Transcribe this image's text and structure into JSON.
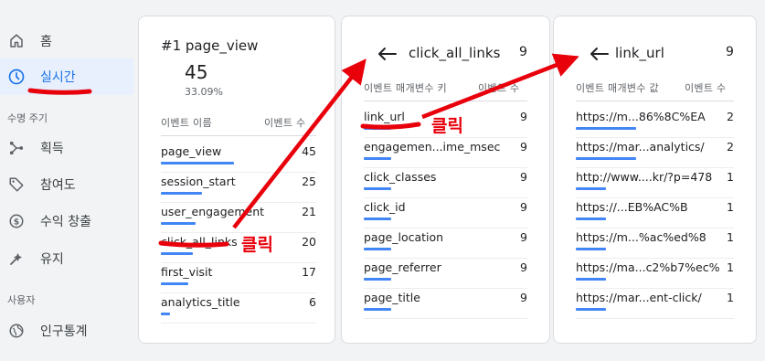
{
  "sidebar": {
    "items": [
      {
        "label": "홈",
        "icon": "home-icon"
      },
      {
        "label": "실시간",
        "icon": "clock-icon"
      },
      {
        "label": "획득",
        "icon": "acquisition-icon"
      },
      {
        "label": "참여도",
        "icon": "tag-icon"
      },
      {
        "label": "수익 창출",
        "icon": "dollar-icon"
      },
      {
        "label": "유지",
        "icon": "retention-icon"
      },
      {
        "label": "인구통계",
        "icon": "globe-icon"
      }
    ],
    "section_lifecycle": "수명 주기",
    "section_user": "사용자"
  },
  "card1": {
    "title": "#1 page_view",
    "total": "45",
    "percent": "33.09%",
    "col_name": "이벤트 이름",
    "col_value": "이벤트 수",
    "rows": [
      {
        "name": "page_view",
        "value": "45",
        "fraction": 1.0
      },
      {
        "name": "session_start",
        "value": "25",
        "fraction": 0.56
      },
      {
        "name": "user_engagement",
        "value": "21",
        "fraction": 0.47
      },
      {
        "name": "click_all_links",
        "value": "20",
        "fraction": 0.44
      },
      {
        "name": "first_visit",
        "value": "17",
        "fraction": 0.38
      },
      {
        "name": "analytics_title",
        "value": "6",
        "fraction": 0.13
      }
    ]
  },
  "card2": {
    "title": "click_all_links",
    "count": "9",
    "col_name": "이벤트 매개변수 키",
    "col_value": "이벤트 수",
    "rows": [
      {
        "name": "link_url",
        "value": "9",
        "fraction": 1.0
      },
      {
        "name": "engagemen...ime_msec",
        "value": "9",
        "fraction": 1.0
      },
      {
        "name": "click_classes",
        "value": "9",
        "fraction": 1.0
      },
      {
        "name": "click_id",
        "value": "9",
        "fraction": 1.0
      },
      {
        "name": "page_location",
        "value": "9",
        "fraction": 1.0
      },
      {
        "name": "page_referrer",
        "value": "9",
        "fraction": 1.0
      },
      {
        "name": "page_title",
        "value": "9",
        "fraction": 1.0
      }
    ]
  },
  "card3": {
    "title": "link_url",
    "count": "9",
    "col_name": "이벤트 매개변수 값",
    "col_value": "이벤트 수",
    "rows": [
      {
        "name": "https://m...86%8C%EA",
        "value": "2",
        "fraction": 1.0
      },
      {
        "name": "https://mar...analytics/",
        "value": "2",
        "fraction": 1.0
      },
      {
        "name": "http://www....kr/?p=478",
        "value": "1",
        "fraction": 0.5
      },
      {
        "name": "https://...EB%AC%B",
        "value": "1",
        "fraction": 0.5
      },
      {
        "name": "https://m...%ac%ed%8",
        "value": "1",
        "fraction": 0.5
      },
      {
        "name": "https://ma...c2%b7%ec%",
        "value": "1",
        "fraction": 0.5
      },
      {
        "name": "https://mar...ent-click/",
        "value": "1",
        "fraction": 0.5
      }
    ]
  },
  "annotations": {
    "click_label_1": "클릭",
    "click_label_2": "클릭",
    "color": "#e8000b"
  },
  "colors": {
    "accent": "#1a73e8",
    "bar": "#4285f4",
    "active_bg": "#e8f0fe"
  }
}
